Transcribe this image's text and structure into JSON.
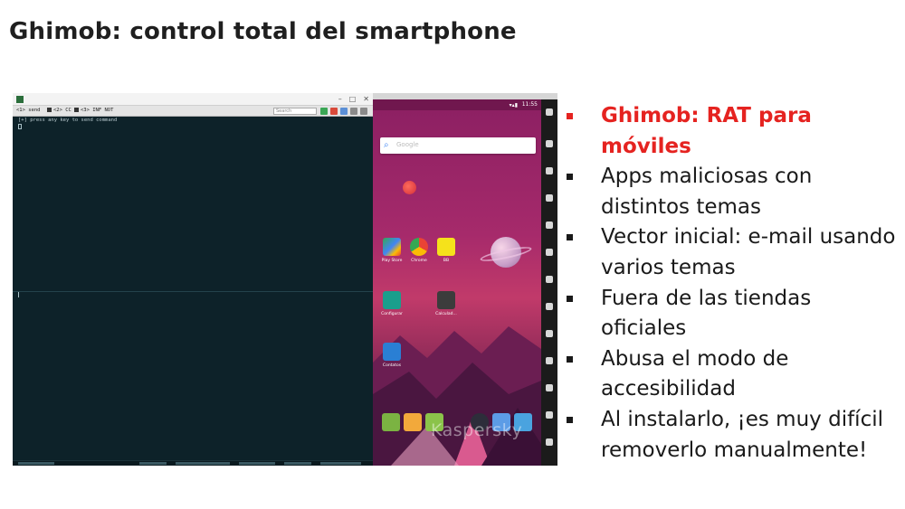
{
  "slide": {
    "title": "Ghimob: control total del smartphone"
  },
  "terminal": {
    "tabs": [
      "<1> send",
      "<2> CC",
      "<3> INF NOT"
    ],
    "search_placeholder": "Search",
    "prompt": "[+] press any key to send command"
  },
  "emulator": {
    "clock": "11:55",
    "search_placeholder": "Google",
    "apps": [
      "Play Store",
      "Chrome",
      "BB",
      "Configurar",
      "Calculad...",
      "Contatos"
    ],
    "watermark": "Kaspersky"
  },
  "bullets": [
    {
      "text": "Ghimob: RAT para móviles",
      "highlight": true
    },
    {
      "text": "Apps maliciosas con distintos temas",
      "highlight": false
    },
    {
      "text": "Vector inicial: e-mail usando varios temas",
      "highlight": false
    },
    {
      "text": "Fuera de las tiendas oficiales",
      "highlight": false
    },
    {
      "text": "Abusa el modo de accesibilidad",
      "highlight": false
    },
    {
      "text": "Al instalarlo, ¡es muy difícil removerlo manualmente!",
      "highlight": false
    }
  ],
  "colors": {
    "accent_red": "#e52320",
    "terminal_bg": "#0d2229",
    "android_wallpaper": "#a62a6b"
  }
}
